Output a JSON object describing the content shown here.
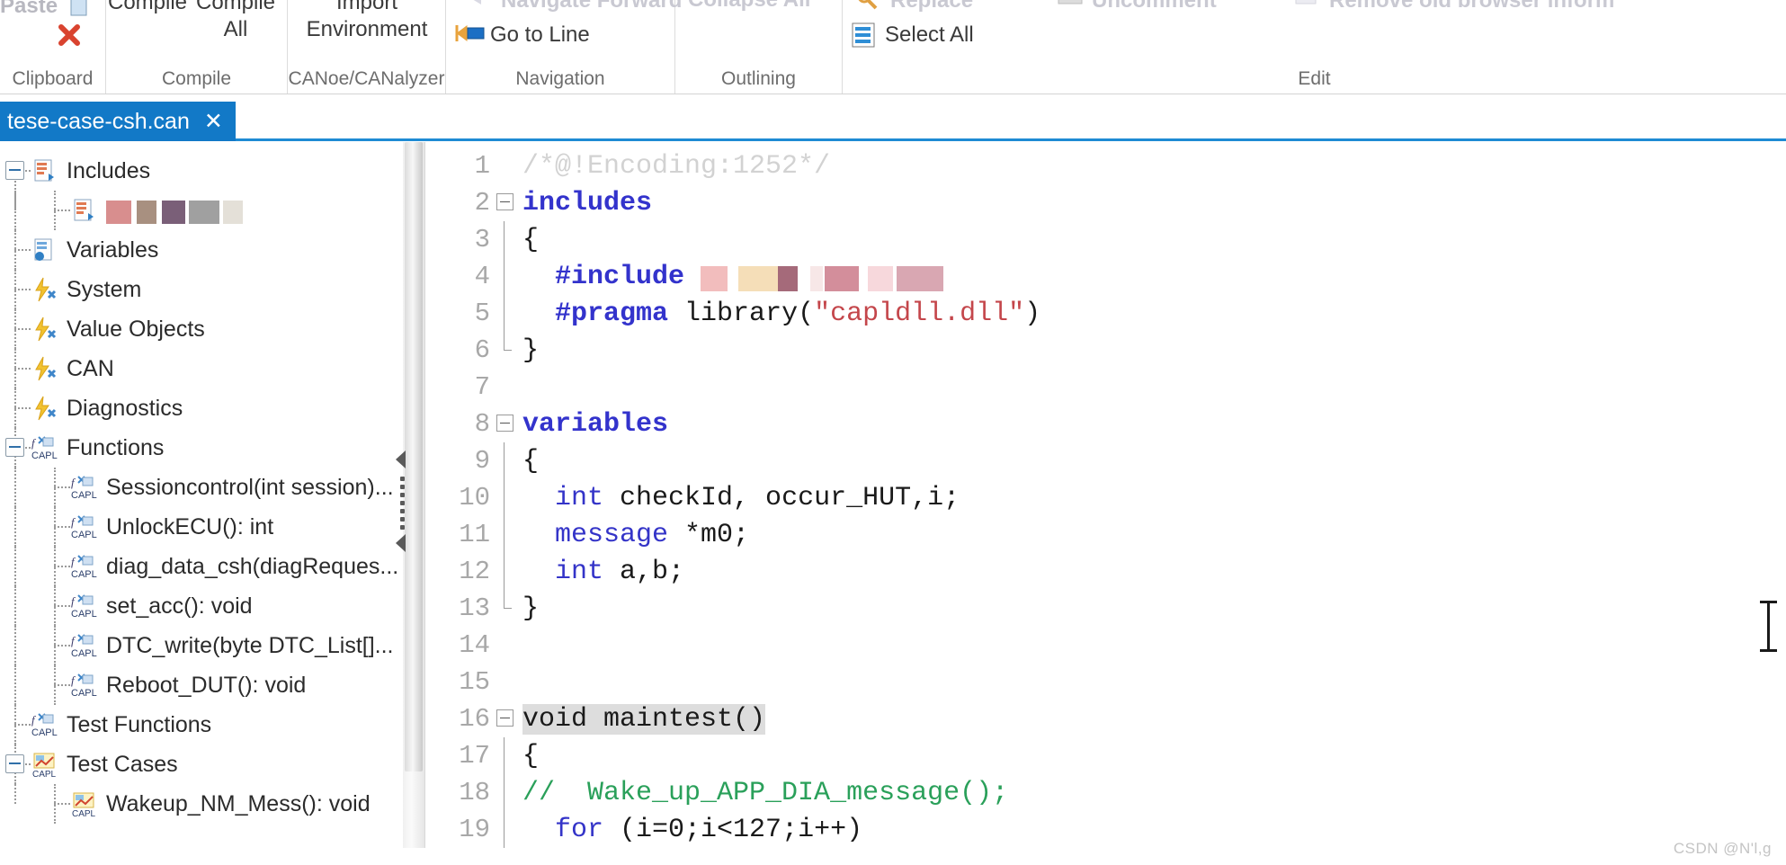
{
  "ribbon": {
    "groups": [
      {
        "name": "Clipboard",
        "label": "Clipboard",
        "items": [
          {
            "label": "Paste",
            "icon": "paste-icon",
            "state": "dim"
          },
          {
            "label": "",
            "icon": "delete-x-icon",
            "state": "normal"
          }
        ]
      },
      {
        "name": "Compile",
        "label": "Compile",
        "items": [
          {
            "label": "Compile",
            "icon": "compile-icon",
            "state": "normal"
          },
          {
            "label": "Compile\nAll",
            "icon": "compile-all-icon",
            "state": "normal"
          }
        ]
      },
      {
        "name": "CANoe/CANalyzer",
        "label": "CANoe/CANalyzer",
        "items": [
          {
            "label": "Import\nEnvironment",
            "icon": "import-environment-icon",
            "state": "normal"
          }
        ]
      },
      {
        "name": "Navigation",
        "label": "Navigation",
        "items": [
          {
            "label": "Navigate Forward",
            "icon": "navigate-forward-icon",
            "state": "clipped"
          },
          {
            "label": "Go to Line",
            "icon": "go-to-line-icon",
            "state": "normal"
          }
        ]
      },
      {
        "name": "Outlining",
        "label": "Outlining",
        "items": [
          {
            "label": "Collapse All",
            "icon": "collapse-all-icon",
            "state": "clipped"
          }
        ]
      },
      {
        "name": "Edit",
        "label": "Edit",
        "items": [
          {
            "label": "Replace",
            "icon": "replace-icon",
            "state": "clipped"
          },
          {
            "label": "Uncomment",
            "icon": "uncomment-icon",
            "state": "clipped"
          },
          {
            "label": "Remove old browser inform",
            "icon": "remove-browser-info-icon",
            "state": "clipped"
          },
          {
            "label": "Select All",
            "icon": "select-all-icon",
            "state": "normal"
          }
        ]
      }
    ]
  },
  "tabs": {
    "active": "tese-case-csh.can",
    "close_glyph": "✕"
  },
  "tree": {
    "nodes": [
      {
        "label": "Includes",
        "icon": "includes-icon",
        "depth": 0,
        "expander": "minus",
        "redacted": false
      },
      {
        "label": "",
        "icon": "include-file-icon",
        "depth": 1,
        "expander": "none",
        "redacted": true
      },
      {
        "label": "Variables",
        "icon": "variables-icon",
        "depth": 0,
        "expander": "none",
        "redacted": false
      },
      {
        "label": "System",
        "icon": "event-icon",
        "depth": 0,
        "expander": "none",
        "redacted": false
      },
      {
        "label": "Value Objects",
        "icon": "event-icon",
        "depth": 0,
        "expander": "none",
        "redacted": false
      },
      {
        "label": "CAN",
        "icon": "event-icon",
        "depth": 0,
        "expander": "none",
        "redacted": false
      },
      {
        "label": "Diagnostics",
        "icon": "event-icon",
        "depth": 0,
        "expander": "none",
        "redacted": false
      },
      {
        "label": "Functions",
        "icon": "capl-function-icon",
        "depth": 0,
        "expander": "minus",
        "redacted": false
      },
      {
        "label": "Sessioncontrol(int session)...",
        "icon": "capl-function-icon",
        "depth": 1,
        "expander": "none",
        "redacted": false
      },
      {
        "label": "UnlockECU(): int",
        "icon": "capl-function-icon",
        "depth": 1,
        "expander": "none",
        "redacted": false
      },
      {
        "label": "diag_data_csh(diagReques...",
        "icon": "capl-function-icon",
        "depth": 1,
        "expander": "none",
        "redacted": false
      },
      {
        "label": "set_acc(): void",
        "icon": "capl-function-icon",
        "depth": 1,
        "expander": "none",
        "redacted": false
      },
      {
        "label": "DTC_write(byte DTC_List[]...",
        "icon": "capl-function-icon",
        "depth": 1,
        "expander": "none",
        "redacted": false
      },
      {
        "label": "Reboot_DUT(): void",
        "icon": "capl-function-icon",
        "depth": 1,
        "expander": "none",
        "redacted": false
      },
      {
        "label": "Test Functions",
        "icon": "capl-function-icon",
        "depth": 0,
        "expander": "none",
        "redacted": false
      },
      {
        "label": "Test Cases",
        "icon": "test-case-icon",
        "depth": 0,
        "expander": "minus",
        "redacted": false
      },
      {
        "label": "Wakeup_NM_Mess(): void",
        "icon": "test-case-icon",
        "depth": 1,
        "expander": "none",
        "redacted": false
      }
    ]
  },
  "editor": {
    "lines": [
      {
        "n": "1",
        "fold": "none",
        "tokens": [
          {
            "t": "/*@!Encoding:1252*/",
            "c": "comment-gray"
          }
        ]
      },
      {
        "n": "2",
        "fold": "start",
        "tokens": [
          {
            "t": "includes",
            "c": "keyword"
          }
        ]
      },
      {
        "n": "3",
        "fold": "bar",
        "tokens": [
          {
            "t": "{",
            "c": "plain"
          }
        ]
      },
      {
        "n": "4",
        "fold": "bar",
        "tokens": [
          {
            "t": "  ",
            "c": "plain"
          },
          {
            "t": "#include",
            "c": "keyword"
          },
          {
            "t": " ",
            "c": "plain"
          },
          {
            "t": "",
            "c": "redacted"
          }
        ]
      },
      {
        "n": "5",
        "fold": "bar",
        "tokens": [
          {
            "t": "  ",
            "c": "plain"
          },
          {
            "t": "#pragma",
            "c": "keyword"
          },
          {
            "t": " library(",
            "c": "plain"
          },
          {
            "t": "\"capldll.dll\"",
            "c": "string"
          },
          {
            "t": ")",
            "c": "plain"
          }
        ]
      },
      {
        "n": "6",
        "fold": "end",
        "tokens": [
          {
            "t": "}",
            "c": "plain"
          }
        ]
      },
      {
        "n": "7",
        "fold": "none",
        "tokens": []
      },
      {
        "n": "8",
        "fold": "start",
        "tokens": [
          {
            "t": "variables",
            "c": "keyword"
          }
        ]
      },
      {
        "n": "9",
        "fold": "bar",
        "tokens": [
          {
            "t": "{",
            "c": "plain"
          }
        ]
      },
      {
        "n": "10",
        "fold": "bar",
        "tokens": [
          {
            "t": "  ",
            "c": "plain"
          },
          {
            "t": "int",
            "c": "kw2"
          },
          {
            "t": " checkId, occur_HUT,i;",
            "c": "plain"
          }
        ]
      },
      {
        "n": "11",
        "fold": "bar",
        "tokens": [
          {
            "t": "  ",
            "c": "plain"
          },
          {
            "t": "message",
            "c": "kw2"
          },
          {
            "t": " *m0;",
            "c": "plain"
          }
        ]
      },
      {
        "n": "12",
        "fold": "bar",
        "tokens": [
          {
            "t": "  ",
            "c": "plain"
          },
          {
            "t": "int",
            "c": "kw2"
          },
          {
            "t": " a,b;",
            "c": "plain"
          }
        ]
      },
      {
        "n": "13",
        "fold": "end",
        "tokens": [
          {
            "t": "}",
            "c": "plain"
          }
        ]
      },
      {
        "n": "14",
        "fold": "none",
        "tokens": []
      },
      {
        "n": "15",
        "fold": "none",
        "tokens": []
      },
      {
        "n": "16",
        "fold": "start",
        "tokens": [
          {
            "t": "void maintest()",
            "c": "highlight"
          }
        ]
      },
      {
        "n": "17",
        "fold": "bar",
        "tokens": [
          {
            "t": "{",
            "c": "plain"
          }
        ]
      },
      {
        "n": "18",
        "fold": "bar",
        "tokens": [
          {
            "t": "// ",
            "c": "green"
          },
          {
            "t": " Wake_up_APP_DIA_message();",
            "c": "green"
          }
        ]
      },
      {
        "n": "19",
        "fold": "bar",
        "tokens": [
          {
            "t": "  ",
            "c": "plain"
          },
          {
            "t": "for",
            "c": "kw2"
          },
          {
            "t": " (i=0;i<127;i++)",
            "c": "plain"
          }
        ]
      }
    ]
  },
  "watermark": "CSDN @N'l,g"
}
